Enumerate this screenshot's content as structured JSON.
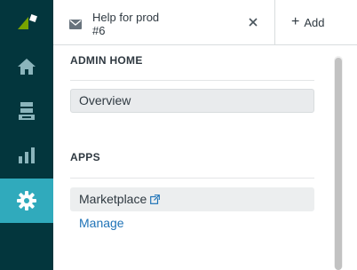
{
  "nav_rail": {
    "items": [
      {
        "name": "zendesk-logo",
        "icon": "zendesk-logo-icon"
      },
      {
        "name": "home",
        "icon": "home-icon"
      },
      {
        "name": "views",
        "icon": "views-icon"
      },
      {
        "name": "reporting",
        "icon": "reports-icon"
      },
      {
        "name": "admin",
        "icon": "gear-icon",
        "active": true
      }
    ],
    "colors": {
      "background": "#03363d",
      "active": "#30aabc",
      "icon": "#8bb5bc",
      "logo": "#78a300"
    }
  },
  "tabs": {
    "ticket": {
      "title": "Help for prod",
      "subtitle": "#6",
      "icon": "mail-icon",
      "close_icon": "close-icon"
    },
    "add_label": "Add"
  },
  "admin_nav": {
    "sections": [
      {
        "title": "ADMIN HOME",
        "items": [
          {
            "label": "Overview",
            "selected": true
          }
        ]
      },
      {
        "title": "APPS",
        "items": [
          {
            "label": "Marketplace",
            "external": true
          },
          {
            "label": "Manage"
          }
        ]
      }
    ]
  }
}
